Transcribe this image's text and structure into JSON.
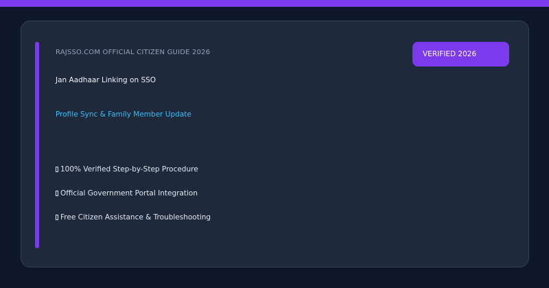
{
  "colors": {
    "page_background": "#0f172a",
    "accent": "#7c3aed",
    "card_background": "#1e293b",
    "link_blue": "#38bdf8"
  },
  "card": {
    "eyebrow": "RAJSSO.COM OFFICIAL CITIZEN GUIDE 2026",
    "title": "Jan Aadhaar Linking on SSO",
    "subtitle": "Profile Sync & Family Member Update",
    "badge": "VERIFIED 2026",
    "features": [
      {
        "icon": "check-icon",
        "text": "100% Verified Step-by-Step Procedure"
      },
      {
        "icon": "check-icon",
        "text": "Official Government Portal Integration"
      },
      {
        "icon": "check-icon",
        "text": "Free Citizen Assistance & Troubleshooting"
      }
    ]
  }
}
